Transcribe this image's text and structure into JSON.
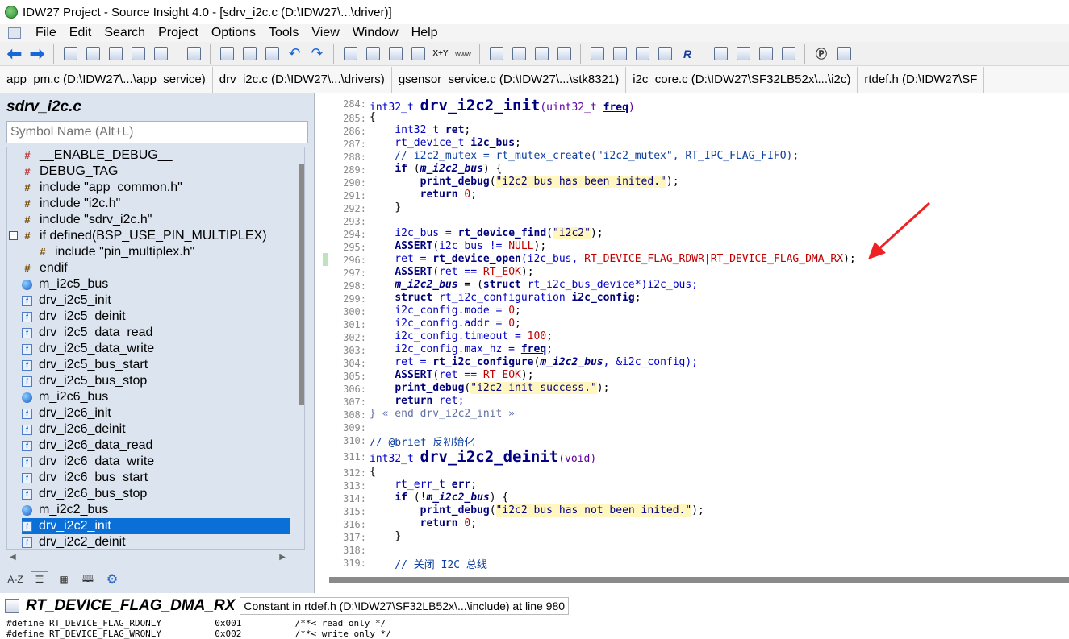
{
  "window": {
    "title": "IDW27 Project - Source Insight 4.0 - [sdrv_i2c.c (D:\\IDW27\\...\\driver)]"
  },
  "menu": [
    "File",
    "Edit",
    "Search",
    "Project",
    "Options",
    "Tools",
    "View",
    "Window",
    "Help"
  ],
  "tabs": [
    {
      "label": "app_pm.c (D:\\IDW27\\...\\app_service)",
      "active": false
    },
    {
      "label": "drv_i2c.c (D:\\IDW27\\...\\drivers)",
      "active": false
    },
    {
      "label": "gsensor_service.c (D:\\IDW27\\...\\stk8321)",
      "active": false
    },
    {
      "label": "i2c_core.c (D:\\IDW27\\SF32LB52x\\...\\i2c)",
      "active": false
    },
    {
      "label": "rtdef.h (D:\\IDW27\\SF",
      "active": false
    }
  ],
  "symbols": {
    "file_title": "sdrv_i2c.c",
    "search_placeholder": "Symbol Name (Alt+L)",
    "items": [
      {
        "label": "__ENABLE_DEBUG__",
        "icon": "macro-red-icon",
        "indent": 0
      },
      {
        "label": "DEBUG_TAG",
        "icon": "macro-red-icon",
        "indent": 0
      },
      {
        "label": "include \"app_common.h\"",
        "icon": "include-icon",
        "indent": 0
      },
      {
        "label": "include \"i2c.h\"",
        "icon": "include-icon",
        "indent": 0
      },
      {
        "label": "include \"sdrv_i2c.h\"",
        "icon": "include-icon",
        "indent": 0
      },
      {
        "label": "if defined(BSP_USE_PIN_MULTIPLEX)",
        "icon": "include-icon",
        "indent": 0,
        "expander": "−"
      },
      {
        "label": "include \"pin_multiplex.h\"",
        "icon": "include-icon",
        "indent": 1
      },
      {
        "label": "endif",
        "icon": "include-icon",
        "indent": 0
      },
      {
        "label": "m_i2c5_bus",
        "icon": "variable-icon",
        "indent": 0
      },
      {
        "label": "drv_i2c5_init",
        "icon": "function-icon",
        "indent": 0
      },
      {
        "label": "drv_i2c5_deinit",
        "icon": "function-icon",
        "indent": 0
      },
      {
        "label": "drv_i2c5_data_read",
        "icon": "function-icon",
        "indent": 0
      },
      {
        "label": "drv_i2c5_data_write",
        "icon": "function-icon",
        "indent": 0
      },
      {
        "label": "drv_i2c5_bus_start",
        "icon": "function-icon",
        "indent": 0
      },
      {
        "label": "drv_i2c5_bus_stop",
        "icon": "function-icon",
        "indent": 0
      },
      {
        "label": "m_i2c6_bus",
        "icon": "variable-icon",
        "indent": 0
      },
      {
        "label": "drv_i2c6_init",
        "icon": "function-icon",
        "indent": 0
      },
      {
        "label": "drv_i2c6_deinit",
        "icon": "function-icon",
        "indent": 0
      },
      {
        "label": "drv_i2c6_data_read",
        "icon": "function-icon",
        "indent": 0
      },
      {
        "label": "drv_i2c6_data_write",
        "icon": "function-icon",
        "indent": 0
      },
      {
        "label": "drv_i2c6_bus_start",
        "icon": "function-icon",
        "indent": 0
      },
      {
        "label": "drv_i2c6_bus_stop",
        "icon": "function-icon",
        "indent": 0
      },
      {
        "label": "m_i2c2_bus",
        "icon": "variable-icon",
        "indent": 0
      },
      {
        "label": "drv_i2c2_init",
        "icon": "function-icon",
        "indent": 0,
        "selected": true
      },
      {
        "label": "drv_i2c2_deinit",
        "icon": "function-icon",
        "indent": 0
      }
    ],
    "bottom_buttons": [
      "A-Z",
      "list-icon",
      "category-icon",
      "book-icon",
      "gear-icon"
    ]
  },
  "code": {
    "line_numbers": [
      "284:",
      "285:",
      "286:",
      "287:",
      "288:",
      "289:",
      "290:",
      "291:",
      "292:",
      "293:",
      "294:",
      "295:",
      "296:",
      "297:",
      "298:",
      "299:",
      "300:",
      "301:",
      "302:",
      "303:",
      "304:",
      "305:",
      "306:",
      "307:",
      "308:",
      "309:",
      "310:",
      "311:",
      "312:",
      "313:",
      "314:",
      "315:",
      "316:",
      "317:",
      "318:",
      "319:"
    ],
    "t": {
      "int32_t": "int32_t ",
      "drv_i2c2_init": "drv_i2c2_init",
      "uint32_t": "uint32_t ",
      "freq": "freq",
      "lp": "(",
      "rp": ")",
      "brace_open": "{",
      "brace_close": "}",
      "l286a": "    int32_t ",
      "ret": "ret",
      "semi": ";",
      "l287a": "    rt_device_t ",
      "i2c_bus": "i2c_bus",
      "l288": "    // i2c2_mutex = rt_mutex_create(\"i2c2_mutex\", RT_IPC_FLAG_FIFO);",
      "if": "if",
      "m_i2c2_bus": "m_i2c2_bus",
      "print_debug": "print_debug",
      "s_inited": "\"i2c2 bus has been inited.\"",
      "return": "return",
      "zero": "0",
      "l294a": "    i2c_bus = ",
      "rt_device_find": "rt_device_find",
      "s_i2c2": "\"i2c2\"",
      "ASSERT": "ASSERT",
      "l295b": "(i2c_bus != ",
      "NULL": "NULL",
      "l296a": "    ret = ",
      "rt_device_open": "rt_device_open",
      "l296b": "(i2c_bus, ",
      "RDWR": "RT_DEVICE_FLAG_RDWR",
      "bar": "|",
      "DMA_RX": "RT_DEVICE_FLAG_DMA_RX",
      "l296c": ");",
      "l297b": "(ret == ",
      "RT_EOK": "RT_EOK",
      "l298b": " = (",
      "struct": "struct",
      "l298c": " rt_i2c_bus_device*)i2c_bus;",
      "l299b": " rt_i2c_configuration ",
      "i2c_config": "i2c_config",
      "l300": "    i2c_config.mode = ",
      "l301": "    i2c_config.addr = ",
      "l302": "    i2c_config.timeout = ",
      "n100": "100",
      "l303": "    i2c_config.max_hz = ",
      "rt_i2c_configure": "rt_i2c_configure",
      "l304c": ", &i2c_config);",
      "s_success": "\"i2c2 init success.\"",
      "l307b": " ret;",
      "l308": "} « end drv_i2c2_init »",
      "l310": "// @brief 反初始化",
      "drv_i2c2_deinit": "drv_i2c2_deinit",
      "void": "void",
      "l313a": "    rt_err_t ",
      "err": "err",
      "l314b": " (!",
      "s_notinited": "\"i2c2 bus has not been inited.\"",
      "l319": "    // 关闭 I2C 总线"
    }
  },
  "context": {
    "symbol": "RT_DEVICE_FLAG_DMA_RX",
    "description": "Constant in rtdef.h (D:\\IDW27\\SF32LB52x\\...\\include) at line 980",
    "lines": [
      "#define RT_DEVICE_FLAG_RDONLY          0x001          /**< read only */",
      "#define RT_DEVICE_FLAG_WRONLY          0x002          /**< write only */"
    ]
  }
}
